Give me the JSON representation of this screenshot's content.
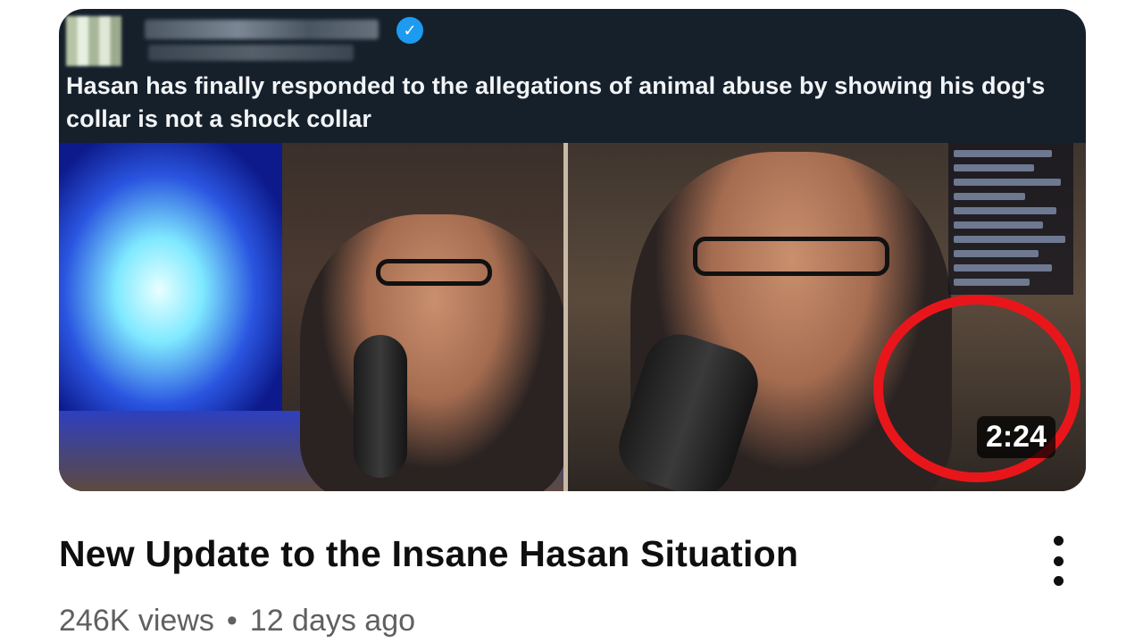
{
  "thumbnail": {
    "tweet_text": "Hasan has finally responded to the allegations of animal abuse by showing his dog's collar is not a shock collar",
    "verified_badge": "✓",
    "duration": "2:24",
    "highlight_color": "#e8161b"
  },
  "video": {
    "title": "New Update to the Insane Hasan Situation",
    "views": "246K views",
    "separator": "•",
    "age": "12 days ago"
  },
  "icons": {
    "menu": "more-vert-icon",
    "verified": "verified-badge-icon"
  }
}
